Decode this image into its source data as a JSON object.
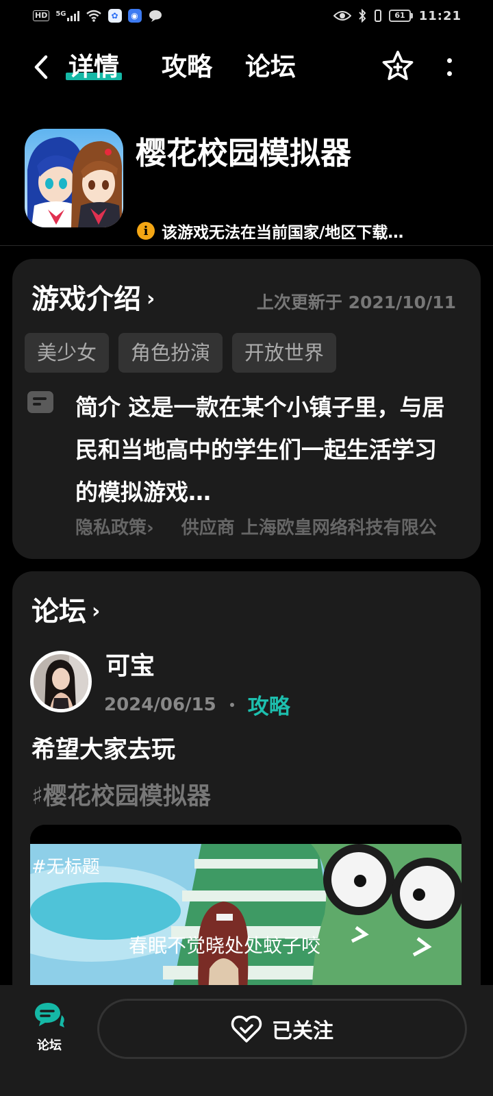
{
  "status_bar": {
    "hd": "HD",
    "network": "5G",
    "battery": "61",
    "time": "11:21"
  },
  "nav": {
    "tabs": [
      "详情",
      "攻略",
      "论坛"
    ],
    "active_tab": "详情"
  },
  "app": {
    "title": "樱花校园模拟器",
    "region_note": "该游戏无法在当前国家/地区下载…"
  },
  "intro": {
    "heading": "游戏介绍",
    "updated": "上次更新于 2021/10/11",
    "tags": [
      "美少女",
      "角色扮演",
      "开放世界"
    ],
    "description": "简介 这是一款在某个小镇子里，与居民和当地高中的学生们一起生活学习的模拟游戏…",
    "privacy": "隐私政策",
    "privacy_chevron": "›",
    "vendor": "供应商 上海欧皇网络科技有限公"
  },
  "forum": {
    "heading": "论坛",
    "post": {
      "author": "可宝",
      "date": "2024/06/15",
      "category": "攻略",
      "title": "希望大家去玩",
      "hashtag": "♯樱花校园模拟器",
      "image_caption_top": "#无标题",
      "image_caption": "春眠不觉晓处处蚊子咬"
    }
  },
  "bottom": {
    "forum_label": "论坛",
    "follow_label": "已关注"
  },
  "colors": {
    "accent": "#15b8a6",
    "card": "#1c1c1c",
    "warning": "#f4a614"
  }
}
